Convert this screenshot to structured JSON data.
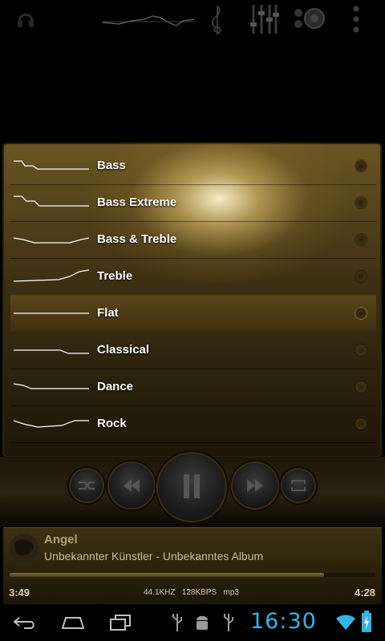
{
  "presets": [
    {
      "label": "Bass",
      "curve": "bass",
      "selected": false
    },
    {
      "label": "Bass Extreme",
      "curve": "bass-extreme",
      "selected": false
    },
    {
      "label": "Bass & Treble",
      "curve": "bass-treble",
      "selected": false
    },
    {
      "label": "Treble",
      "curve": "treble",
      "selected": false
    },
    {
      "label": "Flat",
      "curve": "flat",
      "selected": true
    },
    {
      "label": "Classical",
      "curve": "classical",
      "selected": false
    },
    {
      "label": "Dance",
      "curve": "dance",
      "selected": false
    },
    {
      "label": "Rock",
      "curve": "rock",
      "selected": false
    }
  ],
  "now_playing": {
    "title": "Angel",
    "artist_album": "Unbekannter Künstler - Unbekanntes Album",
    "elapsed": "3:49",
    "total": "4:28",
    "format_info": "44.1KHZ   128KBPS   mp3",
    "progress": 0.86
  },
  "status_bar": {
    "clock": "16:30"
  },
  "icons": {
    "toolbar": [
      "headphones-icon",
      "waveform-icon",
      "treble-clef-icon",
      "equalizer-sliders-icon",
      "speakers-icon",
      "overflow-menu-icon"
    ],
    "transport": [
      "shuffle-icon",
      "rewind-icon",
      "pause-icon",
      "fast-forward-icon",
      "repeat-icon"
    ],
    "nav": [
      "back-icon",
      "home-icon",
      "recent-apps-icon"
    ],
    "status": [
      "usb-icon",
      "android-debug-icon",
      "usb-icon",
      "wifi-icon",
      "battery-charging-icon"
    ]
  },
  "colors": {
    "accent": "#33b5e5",
    "panel_gold": "#6a5523"
  }
}
